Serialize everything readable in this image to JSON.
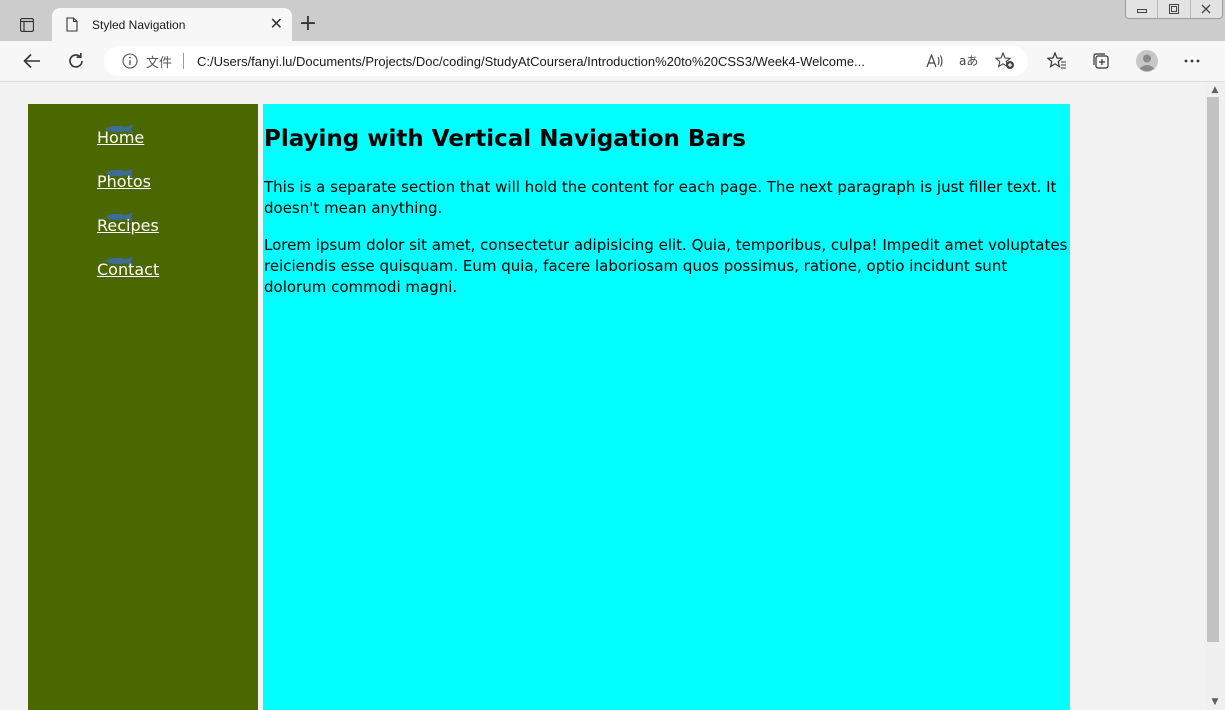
{
  "browser": {
    "tab_title": "Styled Navigation",
    "tab_close": "✕",
    "new_tab": "+",
    "address": {
      "scheme_label": "文件",
      "url": "C:/Users/fanyi.lu/Documents/Projects/Doc/coding/StudyAtCoursera/Introduction%20to%20CSS3/Week4-Welcome..."
    },
    "icons": [
      "sidebar-toggle-icon",
      "page-icon",
      "close-icon",
      "plus-icon",
      "back-arrow-icon",
      "reload-icon",
      "info-icon",
      "read-aloud-icon",
      "translate-icon",
      "add-favorite-icon",
      "favorites-icon",
      "collections-icon",
      "profile-avatar-icon",
      "more-menu-icon"
    ]
  },
  "page": {
    "nav": {
      "items": [
        {
          "label": "Home"
        },
        {
          "label": "Photos"
        },
        {
          "label": "Recipes"
        },
        {
          "label": "Contact"
        }
      ]
    },
    "main": {
      "heading": "Playing with Vertical Navigation Bars",
      "paragraph1": "This is a separate section that will hold the content for each page. The next paragraph is just filler text. It doesn't mean anything.",
      "paragraph2": "Lorem ipsum dolor sit amet, consectetur adipisicing elit. Quia, temporibus, culpa! Impedit amet voluptates reiciendis esse quisquam. Eum quia, facere laboriosam quos possimus, ratione, optio incidunt sunt dolorum commodi magni."
    }
  },
  "colors": {
    "nav_background": "#4a6700",
    "content_background": "#00ffff",
    "page_background": "#f2f2f2",
    "link_color": "#ffffff",
    "fish_color": "#3a6fb5"
  }
}
